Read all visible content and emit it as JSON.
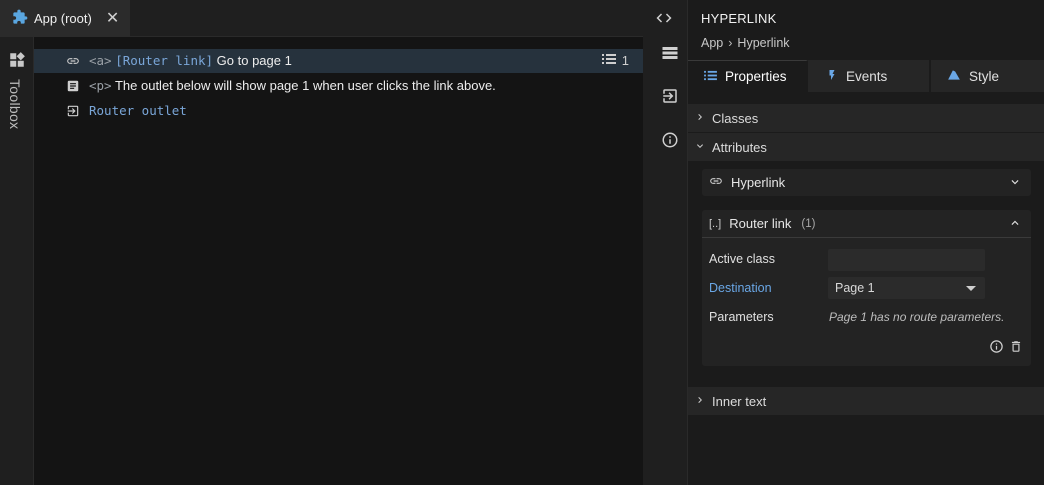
{
  "tab": {
    "title": "App (root)",
    "close": "✕"
  },
  "toolbox": {
    "label": "Toolbox"
  },
  "tree": {
    "rows": [
      {
        "tag": "<a>",
        "attr": "[Router link]",
        "text": "Go to page 1",
        "count": "1"
      },
      {
        "tag": "<p>",
        "text": "The outlet below will show page 1 when user clicks the link above."
      },
      {
        "attr": "Router outlet"
      }
    ]
  },
  "panel": {
    "title": "HYPERLINK",
    "breadcrumb": {
      "root": "App",
      "sep": "›",
      "current": "Hyperlink"
    },
    "tabs": {
      "properties": "Properties",
      "events": "Events",
      "style": "Style"
    },
    "sections": {
      "classes": "Classes",
      "attributes": "Attributes",
      "inner_text": "Inner text"
    },
    "hyperlink_card": {
      "label": "Hyperlink"
    },
    "router_card": {
      "glyph": "[..]",
      "label": "Router link",
      "badge": "(1)",
      "active_class_label": "Active class",
      "active_class_value": "",
      "destination_label": "Destination",
      "destination_value": "Page 1",
      "parameters_label": "Parameters",
      "parameters_note": "Page 1 has no route parameters."
    }
  },
  "colors": {
    "accent_link": "#6aa7e6",
    "selected_row": "#26323d",
    "canvas_bg": "#141414"
  }
}
